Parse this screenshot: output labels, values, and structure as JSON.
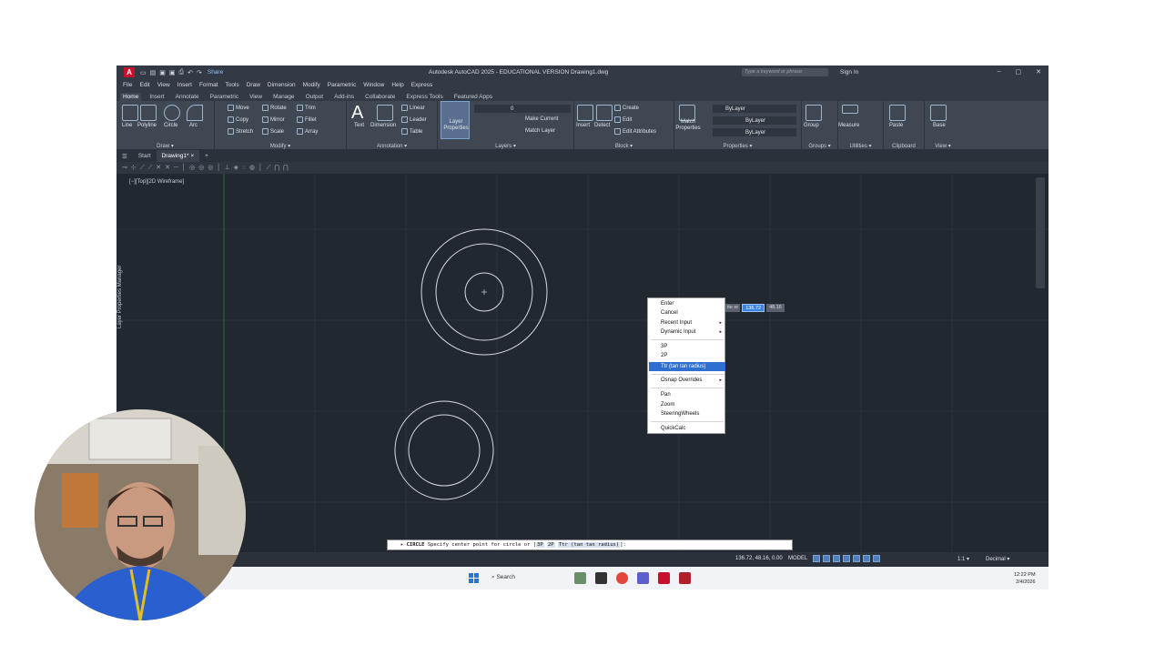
{
  "window": {
    "app_icon": "A",
    "title": "Autodesk AutoCAD 2025 - EDUCATIONAL VERSION   Drawing1.dwg",
    "share": "Share",
    "search_placeholder": "Type a keyword or phrase",
    "sign_in": "Sign In",
    "controls": [
      "–",
      "▢",
      "✕"
    ],
    "controls2": [
      "–",
      "▢",
      "✕"
    ]
  },
  "menu": [
    "File",
    "Edit",
    "View",
    "Insert",
    "Format",
    "Tools",
    "Draw",
    "Dimension",
    "Modify",
    "Parametric",
    "Window",
    "Help",
    "Express"
  ],
  "ribbon_tabs": [
    "Home",
    "Insert",
    "Annotate",
    "Parametric",
    "View",
    "Manage",
    "Output",
    "Add-ins",
    "Collaborate",
    "Express Tools",
    "Featured Apps"
  ],
  "ribbon": {
    "draw": {
      "title": "Draw ▾",
      "line": "Line",
      "polyline": "Polyline",
      "circle": "Circle",
      "arc": "Arc"
    },
    "modify": {
      "title": "Modify ▾",
      "move": "Move",
      "rotate": "Rotate",
      "trim": "Trim",
      "copy": "Copy",
      "mirror": "Mirror",
      "fillet": "Fillet",
      "stretch": "Stretch",
      "scale": "Scale",
      "array": "Array"
    },
    "annotation": {
      "title": "Annotation ▾",
      "text": "Text",
      "dimension": "Dimension",
      "linear": "Linear",
      "leader": "Leader",
      "table": "Table"
    },
    "layers": {
      "title": "Layers ▾",
      "layer_properties": "Layer Properties",
      "current_layer": "0",
      "make_current": "Make Current",
      "match_layer": "Match Layer"
    },
    "block": {
      "title": "Block ▾",
      "insert": "Insert",
      "detect": "Detect",
      "create": "Create",
      "edit": "Edit",
      "edit_attributes": "Edit Attributes"
    },
    "properties": {
      "title": "Properties ▾",
      "match": "Match Properties",
      "bylayer1": "ByLayer",
      "bylayer2": "ByLayer",
      "bylayer3": "ByLayer"
    },
    "groups": {
      "title": "Groups ▾",
      "group": "Group"
    },
    "utilities": {
      "title": "Utilities ▾",
      "measure": "Measure"
    },
    "clipboard": {
      "title": "Clipboard",
      "paste": "Paste"
    },
    "view": {
      "title": "View ▾",
      "base": "Base"
    }
  },
  "doc_tabs": {
    "start": "Start",
    "drawing": "Drawing1*",
    "close": "×",
    "add": "+"
  },
  "viewport": {
    "label": "[−][Top][2D Wireframe]",
    "side_label": "Layer Properties Manager"
  },
  "context_menu": {
    "items": [
      "Enter",
      "Cancel",
      "Recent Input",
      "Dynamic Input",
      "3P",
      "2P",
      "Ttr (tan tan radius)",
      "Osnap Overrides",
      "Pan",
      "Zoom",
      "SteeringWheels",
      "QuickCalc"
    ],
    "submenu_arrow": "▸"
  },
  "dynamic_input": {
    "label": "ite or",
    "x": "136.72",
    "y": "48.16"
  },
  "command_line": {
    "command": "CIRCLE",
    "prompt": "Specify center point for circle or [",
    "opt1": "3P",
    "opt2": "2P",
    "opt3": "Ttr (tan tan radius)",
    "end": "]:"
  },
  "status": {
    "coords": "136.72, 48.16, 0.00",
    "model": "MODEL",
    "scale": "1:1 ▾",
    "units": "Decimal ▾"
  },
  "taskbar": {
    "search": "Search",
    "time": "12:22 PM",
    "date": "2/4/2026"
  }
}
